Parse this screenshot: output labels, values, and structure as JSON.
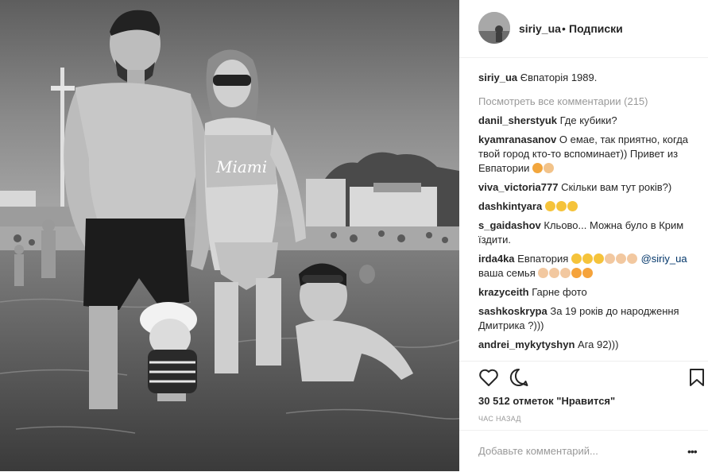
{
  "post": {
    "username": "siriy_ua",
    "separator": "•",
    "follow_label": "Подписки",
    "caption_user": "siriy_ua",
    "caption_text": "Євпаторія 1989.",
    "view_all_label": "Посмотреть все комментарии (215)",
    "comments": [
      {
        "user": "danil_sherstyuk",
        "text": "Где кубики?"
      },
      {
        "user": "kyamranasanov",
        "text": "О емае, так приятно, когда твой город кто-то вспоминает)) Привет из Евпатории",
        "emoji": [
          "#f2a63d",
          "#f2c38a"
        ]
      },
      {
        "user": "viva_victoria777",
        "text": "Скільки вам тут років?)"
      },
      {
        "user": "dashkintyara",
        "text": "",
        "emoji": [
          "#f5c33b",
          "#f5c33b",
          "#f5c33b"
        ]
      },
      {
        "user": "s_gaidashov",
        "text": "Кльово... Можна було в Крим їздити."
      },
      {
        "user": "irda4ka",
        "text": "Евпатория",
        "mention": "@siriy_ua",
        "text2": "ваша семья",
        "emoji": [
          "#f5c33b",
          "#f5c33b",
          "#f5c33b",
          "#f2c8a0",
          "#f2c8a0",
          "#f2c8a0"
        ],
        "emoji2": [
          "#f2c8a0",
          "#f2c8a0",
          "#f2c8a0",
          "#f5a33b",
          "#f5a33b"
        ]
      },
      {
        "user": "krazyceith",
        "text": "Гарне фото"
      },
      {
        "user": "sashkoskrypa",
        "text": "За 19 років до народження Дмитрика ?)))"
      },
      {
        "user": "andrei_mykytyshyn",
        "text": "Ага 92)))"
      }
    ],
    "likes_text": "30 512 отметок \"Нравится\"",
    "time_text": "час назад",
    "add_comment_placeholder": "Добавьте комментарий...",
    "more_label": "•••"
  },
  "icons": {
    "like": "heart-icon",
    "comment": "comment-bubble-icon",
    "save": "bookmark-icon"
  },
  "colors": {
    "text": "#262626",
    "muted": "#999999",
    "mention": "#003569",
    "border": "#efefef"
  }
}
